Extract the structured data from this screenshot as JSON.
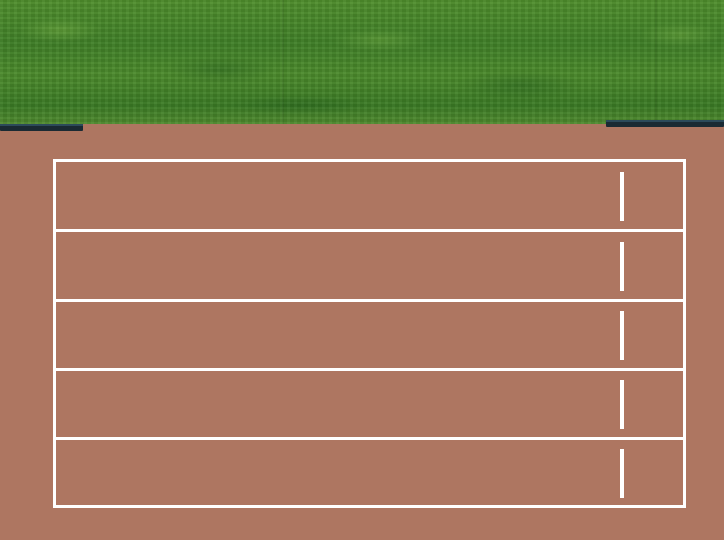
{
  "scene": {
    "colors": {
      "track": "#ae7661",
      "grass": "#4a8a2b",
      "lines": "#ffffff",
      "curb": "#1a2a33"
    },
    "lane_count": 5
  }
}
